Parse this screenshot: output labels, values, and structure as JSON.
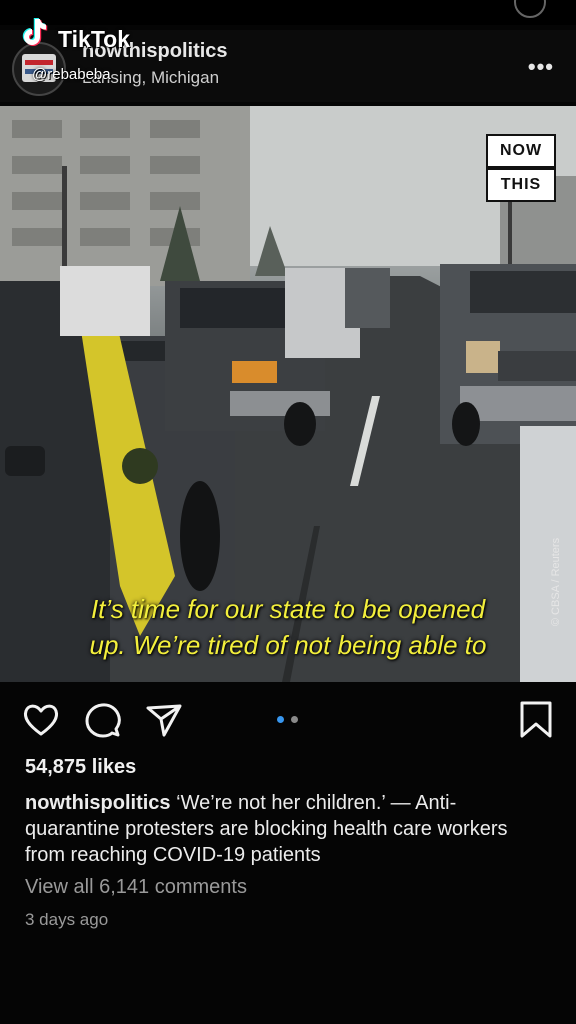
{
  "tiktok": {
    "brand": "TikTok",
    "username": "@rebabeba"
  },
  "post": {
    "account": "nowthispolitics",
    "location": "Lansing, Michigan",
    "more_icon": "more-dots-icon",
    "media": {
      "brand_top": "NOW",
      "brand_bottom": "THIS",
      "credit": "© CBSA / Reuters",
      "caption_line1": "It’s time for our state to be opened",
      "caption_line2": "up. We’re tired of not being able to"
    },
    "actions": {
      "like_icon": "heart-icon",
      "comment_icon": "comment-bubble-icon",
      "share_icon": "paper-plane-icon",
      "save_icon": "bookmark-icon",
      "carousel": {
        "count": 2,
        "active": 0,
        "active_color": "#3897f0"
      }
    },
    "likes": "54,875 likes",
    "caption_user": "nowthispolitics",
    "caption_text": " ‘We’re not her children.’ — Anti-quarantine protesters are blocking health care workers from reaching COVID-19 patients",
    "view_comments": "View all 6,141 comments",
    "time_ago": "3 days ago"
  }
}
